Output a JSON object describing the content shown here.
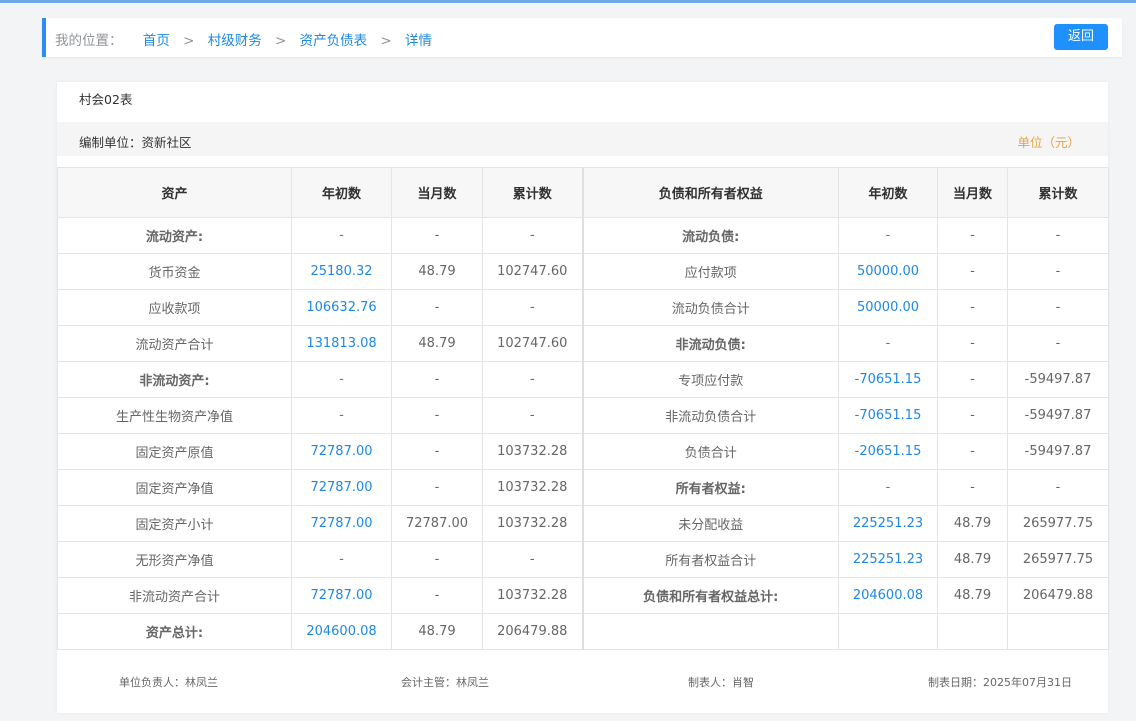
{
  "breadcrumb": {
    "label": "我的位置：",
    "items": [
      "首页",
      "村级财务",
      "资产负债表",
      "详情"
    ],
    "separator": ">"
  },
  "back_button": "返回",
  "report": {
    "code": "村会02表",
    "unit_org": "编制单位：资新社区",
    "currency_unit": "单位（元）"
  },
  "table": {
    "headers": [
      "资产",
      "年初数",
      "当月数",
      "累计数",
      "负债和所有者权益",
      "年初数",
      "当月数",
      "累计数"
    ],
    "rows": [
      {
        "asset": "流动资产:",
        "a_bold": true,
        "a_begin": "-",
        "a_month": "-",
        "a_total": "-",
        "liab": "流动负债:",
        "l_bold": true,
        "l_begin": "-",
        "l_month": "-",
        "l_total": "-"
      },
      {
        "asset": "货币资金",
        "a_bold": false,
        "a_begin": "25180.32",
        "a_month": "48.79",
        "a_total": "102747.60",
        "liab": "应付款项",
        "l_bold": false,
        "l_begin": "50000.00",
        "l_month": "-",
        "l_total": "-"
      },
      {
        "asset": "应收款项",
        "a_bold": false,
        "a_begin": "106632.76",
        "a_month": "-",
        "a_total": "-",
        "liab": "流动负债合计",
        "l_bold": false,
        "l_begin": "50000.00",
        "l_month": "-",
        "l_total": "-"
      },
      {
        "asset": "流动资产合计",
        "a_bold": false,
        "a_begin": "131813.08",
        "a_month": "48.79",
        "a_total": "102747.60",
        "liab": "非流动负债:",
        "l_bold": true,
        "l_begin": "-",
        "l_month": "-",
        "l_total": "-"
      },
      {
        "asset": "非流动资产:",
        "a_bold": true,
        "a_begin": "-",
        "a_month": "-",
        "a_total": "-",
        "liab": "专项应付款",
        "l_bold": false,
        "l_begin": "-70651.15",
        "l_month": "-",
        "l_total": "-59497.87"
      },
      {
        "asset": "生产性生物资产净值",
        "a_bold": false,
        "a_begin": "-",
        "a_month": "-",
        "a_total": "-",
        "liab": "非流动负债合计",
        "l_bold": false,
        "l_begin": "-70651.15",
        "l_month": "-",
        "l_total": "-59497.87"
      },
      {
        "asset": "固定资产原值",
        "a_bold": false,
        "a_begin": "72787.00",
        "a_month": "-",
        "a_total": "103732.28",
        "liab": "负债合计",
        "l_bold": false,
        "l_begin": "-20651.15",
        "l_month": "-",
        "l_total": "-59497.87"
      },
      {
        "asset": "固定资产净值",
        "a_bold": false,
        "a_begin": "72787.00",
        "a_month": "-",
        "a_total": "103732.28",
        "liab": "所有者权益:",
        "l_bold": true,
        "l_begin": "-",
        "l_month": "-",
        "l_total": "-"
      },
      {
        "asset": "固定资产小计",
        "a_bold": false,
        "a_begin": "72787.00",
        "a_month": "72787.00",
        "a_total": "103732.28",
        "liab": "未分配收益",
        "l_bold": false,
        "l_begin": "225251.23",
        "l_month": "48.79",
        "l_total": "265977.75"
      },
      {
        "asset": "无形资产净值",
        "a_bold": false,
        "a_begin": "-",
        "a_month": "-",
        "a_total": "-",
        "liab": "所有者权益合计",
        "l_bold": false,
        "l_begin": "225251.23",
        "l_month": "48.79",
        "l_total": "265977.75"
      },
      {
        "asset": "非流动资产合计",
        "a_bold": false,
        "a_begin": "72787.00",
        "a_month": "-",
        "a_total": "103732.28",
        "liab": "负债和所有者权益总计:",
        "l_bold": true,
        "l_begin": "204600.08",
        "l_month": "48.79",
        "l_total": "206479.88"
      },
      {
        "asset": "资产总计:",
        "a_bold": true,
        "a_begin": "204600.08",
        "a_month": "48.79",
        "a_total": "206479.88",
        "liab": "",
        "l_bold": false,
        "l_begin": "",
        "l_month": "",
        "l_total": ""
      }
    ]
  },
  "footer": {
    "unit_head": "单位负责人：林凤兰",
    "accountant": "会计主管：林凤兰",
    "preparer": "制表人：肖智",
    "date": "制表日期：2025年07月31日"
  },
  "colors": {
    "accent": "#1e88e5",
    "button": "#1e90ff",
    "unit_label": "#e6a23c"
  }
}
